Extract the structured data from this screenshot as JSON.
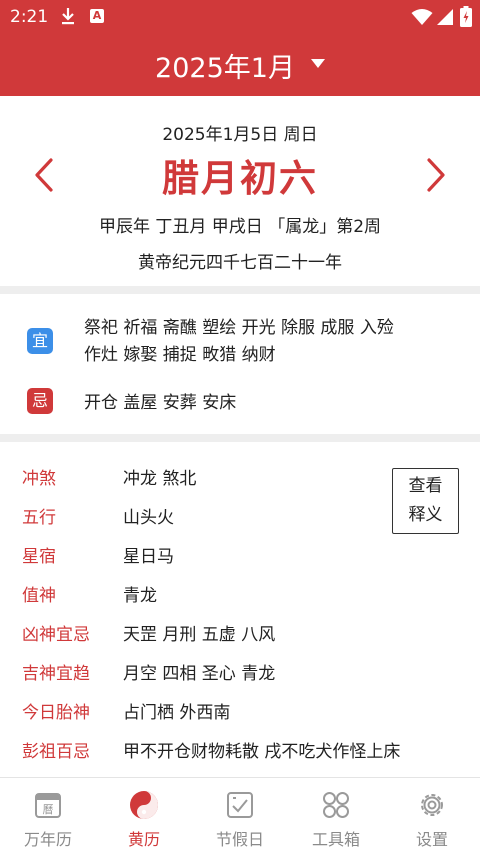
{
  "status_bar": {
    "time": "2:21",
    "badge": "A",
    "icons": [
      "download-icon",
      "a-app-icon",
      "wifi-icon",
      "signal-icon",
      "battery-icon"
    ]
  },
  "header": {
    "month_title": "2025年1月"
  },
  "date_info": {
    "solar_date": "2025年1月5日 周日",
    "lunar_date": "腊月初六",
    "ganzhi": "甲辰年 丁丑月 甲戌日 「属龙」第2周",
    "huangdi": "黄帝纪元四千七百二十一年"
  },
  "yiji": {
    "yi_label": "宜",
    "yi_text": "祭祀 祈福 斋醮 塑绘 开光 除服 成服 入殓 作灶 嫁娶 捕捉 畋猎 纳财",
    "ji_label": "忌",
    "ji_text": "开仓 盖屋 安葬 安床"
  },
  "details": {
    "explain_button": {
      "line1": "查看",
      "line2": "释义"
    },
    "rows": [
      {
        "key": "冲煞",
        "value": "冲龙 煞北"
      },
      {
        "key": "五行",
        "value": "山头火"
      },
      {
        "key": "星宿",
        "value": "星日马"
      },
      {
        "key": "值神",
        "value": "青龙"
      },
      {
        "key": "凶神宜忌",
        "value": "天罡 月刑 五虚 八风"
      },
      {
        "key": "吉神宜趋",
        "value": "月空 四相 圣心 青龙"
      },
      {
        "key": "今日胎神",
        "value": "占门栖 外西南"
      },
      {
        "key": "彭祖百忌",
        "value": "甲不开仓财物耗散 戌不吃犬作怪上床"
      }
    ]
  },
  "bottom_nav": {
    "items": [
      {
        "label": "万年历",
        "icon": "calendar-icon",
        "active": false
      },
      {
        "label": "黄历",
        "icon": "yin-yang-icon",
        "active": true
      },
      {
        "label": "节假日",
        "icon": "holiday-check-icon",
        "active": false
      },
      {
        "label": "工具箱",
        "icon": "toolbox-grid-icon",
        "active": false
      },
      {
        "label": "设置",
        "icon": "settings-gear-icon",
        "active": false
      }
    ]
  },
  "colors": {
    "brand_red": "#d0393a",
    "yi_blue": "#3c8fe8",
    "inactive_gray": "#8a8a8a"
  }
}
